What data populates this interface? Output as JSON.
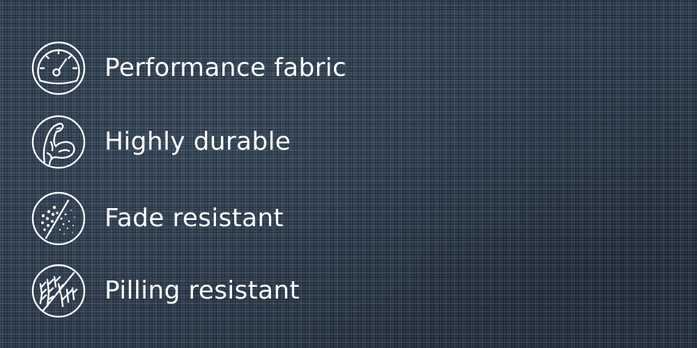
{
  "features": [
    {
      "icon": "speedometer-icon",
      "label": "Performance fabric"
    },
    {
      "icon": "flexed-arm-icon",
      "label": "Highly durable"
    },
    {
      "icon": "fade-dots-icon",
      "label": "Fade resistant"
    },
    {
      "icon": "no-pilling-icon",
      "label": "Pilling resistant"
    }
  ],
  "colors": {
    "background": "#2b3c4f",
    "text": "#ffffff",
    "icon_stroke": "#ffffff"
  }
}
